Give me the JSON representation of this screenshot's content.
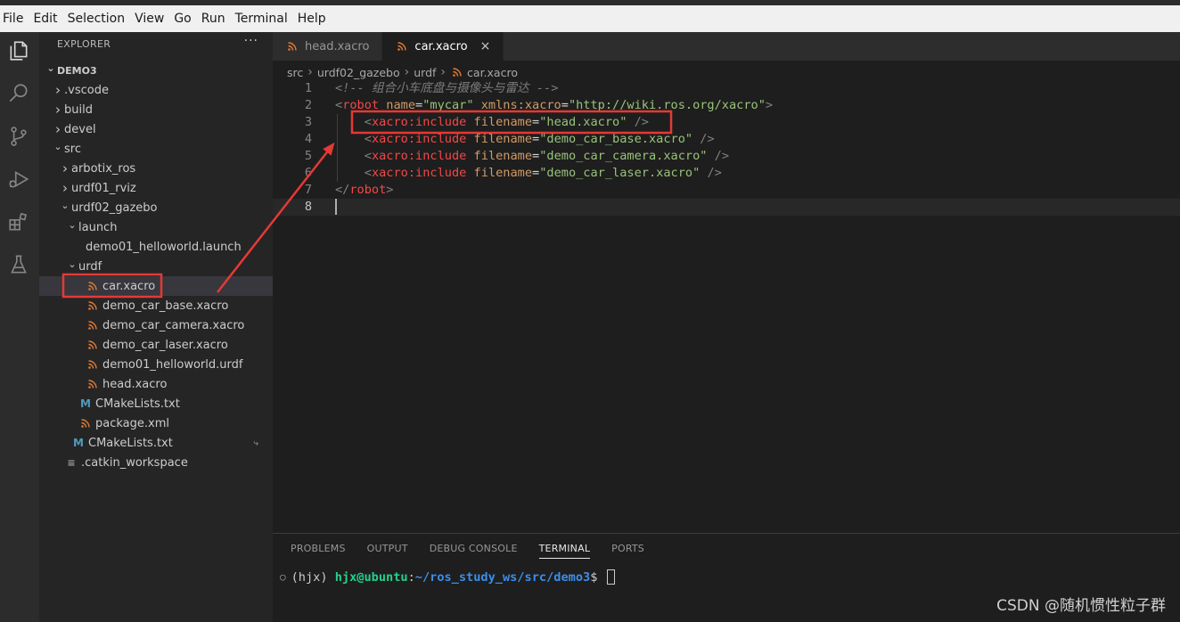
{
  "menu": [
    "File",
    "Edit",
    "Selection",
    "View",
    "Go",
    "Run",
    "Terminal",
    "Help"
  ],
  "activity_icons": [
    "explorer-icon",
    "search-icon",
    "source-control-icon",
    "run-debug-icon",
    "extensions-icon",
    "testing-icon"
  ],
  "sidebar": {
    "title": "EXPLORER",
    "more": "···",
    "tree": [
      {
        "label": "DEMO3",
        "depth": 0,
        "chevron": "open",
        "icon": "",
        "root": true
      },
      {
        "label": ".vscode",
        "depth": 1,
        "chevron": "closed",
        "icon": ""
      },
      {
        "label": "build",
        "depth": 1,
        "chevron": "closed",
        "icon": ""
      },
      {
        "label": "devel",
        "depth": 1,
        "chevron": "closed",
        "icon": ""
      },
      {
        "label": "src",
        "depth": 1,
        "chevron": "open",
        "icon": ""
      },
      {
        "label": "arbotix_ros",
        "depth": 2,
        "chevron": "closed",
        "icon": ""
      },
      {
        "label": "urdf01_rviz",
        "depth": 2,
        "chevron": "closed",
        "icon": ""
      },
      {
        "label": "urdf02_gazebo",
        "depth": 2,
        "chevron": "open",
        "icon": ""
      },
      {
        "label": "launch",
        "depth": 3,
        "chevron": "open",
        "icon": ""
      },
      {
        "label": "demo01_helloworld.launch",
        "depth": 4,
        "chevron": "",
        "icon": ""
      },
      {
        "label": "urdf",
        "depth": 3,
        "chevron": "open",
        "icon": ""
      },
      {
        "label": "car.xacro",
        "depth": 4,
        "chevron": "",
        "icon": "rss",
        "selected": true
      },
      {
        "label": "demo_car_base.xacro",
        "depth": 4,
        "chevron": "",
        "icon": "rss"
      },
      {
        "label": "demo_car_camera.xacro",
        "depth": 4,
        "chevron": "",
        "icon": "rss"
      },
      {
        "label": "demo_car_laser.xacro",
        "depth": 4,
        "chevron": "",
        "icon": "rss"
      },
      {
        "label": "demo01_helloworld.urdf",
        "depth": 4,
        "chevron": "",
        "icon": "rss"
      },
      {
        "label": "head.xacro",
        "depth": 4,
        "chevron": "",
        "icon": "rss"
      },
      {
        "label": "CMakeLists.txt",
        "depth": 3,
        "chevron": "",
        "icon": "m"
      },
      {
        "label": "package.xml",
        "depth": 3,
        "chevron": "",
        "icon": "rss"
      },
      {
        "label": "CMakeLists.txt",
        "depth": 2,
        "chevron": "",
        "icon": "m",
        "git": "⤷"
      },
      {
        "label": ".catkin_workspace",
        "depth": 1,
        "chevron": "",
        "icon": "lines"
      }
    ]
  },
  "tabs": [
    {
      "label": "head.xacro",
      "active": false
    },
    {
      "label": "car.xacro",
      "active": true,
      "close": "×"
    }
  ],
  "breadcrumb": [
    "src",
    "urdf02_gazebo",
    "urdf",
    "car.xacro"
  ],
  "code": [
    {
      "n": "1",
      "parts": [
        [
          "c-comment",
          "<!-- 组合小车底盘与摄像头与雷达 -->"
        ]
      ]
    },
    {
      "n": "2",
      "parts": [
        [
          "c-punct",
          "<"
        ],
        [
          "c-tag",
          "robot"
        ],
        [
          "c-plain",
          " "
        ],
        [
          "c-attr",
          "name"
        ],
        [
          "c-plain",
          "="
        ],
        [
          "c-str",
          "\"mycar\""
        ],
        [
          "c-plain",
          " "
        ],
        [
          "c-attr",
          "xmlns:xacro"
        ],
        [
          "c-plain",
          "="
        ],
        [
          "c-str",
          "\"http://wiki.ros.org/xacro\""
        ],
        [
          "c-punct",
          ">"
        ]
      ]
    },
    {
      "n": "3",
      "parts": [
        [
          "c-plain",
          "    "
        ],
        [
          "c-punct",
          "<"
        ],
        [
          "c-tag",
          "xacro:include"
        ],
        [
          "c-plain",
          " "
        ],
        [
          "c-attr",
          "filename"
        ],
        [
          "c-plain",
          "="
        ],
        [
          "c-str",
          "\"head.xacro\""
        ],
        [
          "c-plain",
          " "
        ],
        [
          "c-punct",
          "/>"
        ]
      ]
    },
    {
      "n": "4",
      "parts": [
        [
          "c-plain",
          "    "
        ],
        [
          "c-punct",
          "<"
        ],
        [
          "c-tag",
          "xacro:include"
        ],
        [
          "c-plain",
          " "
        ],
        [
          "c-attr",
          "filename"
        ],
        [
          "c-plain",
          "="
        ],
        [
          "c-str",
          "\"demo_car_base.xacro\""
        ],
        [
          "c-plain",
          " "
        ],
        [
          "c-punct",
          "/>"
        ]
      ]
    },
    {
      "n": "5",
      "parts": [
        [
          "c-plain",
          "    "
        ],
        [
          "c-punct",
          "<"
        ],
        [
          "c-tag",
          "xacro:include"
        ],
        [
          "c-plain",
          " "
        ],
        [
          "c-attr",
          "filename"
        ],
        [
          "c-plain",
          "="
        ],
        [
          "c-str",
          "\"demo_car_camera.xacro\""
        ],
        [
          "c-plain",
          " "
        ],
        [
          "c-punct",
          "/>"
        ]
      ]
    },
    {
      "n": "6",
      "parts": [
        [
          "c-plain",
          "    "
        ],
        [
          "c-punct",
          "<"
        ],
        [
          "c-tag",
          "xacro:include"
        ],
        [
          "c-plain",
          " "
        ],
        [
          "c-attr",
          "filename"
        ],
        [
          "c-plain",
          "="
        ],
        [
          "c-str",
          "\"demo_car_laser.xacro\""
        ],
        [
          "c-plain",
          " "
        ],
        [
          "c-punct",
          "/>"
        ]
      ]
    },
    {
      "n": "7",
      "parts": [
        [
          "c-punct",
          "</"
        ],
        [
          "c-tag",
          "robot"
        ],
        [
          "c-punct",
          ">"
        ]
      ]
    },
    {
      "n": "8",
      "parts": [],
      "current": true
    }
  ],
  "panel": {
    "tabs": [
      "PROBLEMS",
      "OUTPUT",
      "DEBUG CONSOLE",
      "TERMINAL",
      "PORTS"
    ],
    "active_tab": "TERMINAL",
    "terminal": {
      "dot": "○",
      "env": "(hjx) ",
      "user": "hjx@ubuntu",
      "sep": ":",
      "path": "~/ros_study_ws/src/demo3",
      "prompt": "$ "
    }
  },
  "watermark": "CSDN @随机惯性粒子群",
  "colors": {
    "annotation": "#e53935",
    "accent": "#007acc"
  }
}
